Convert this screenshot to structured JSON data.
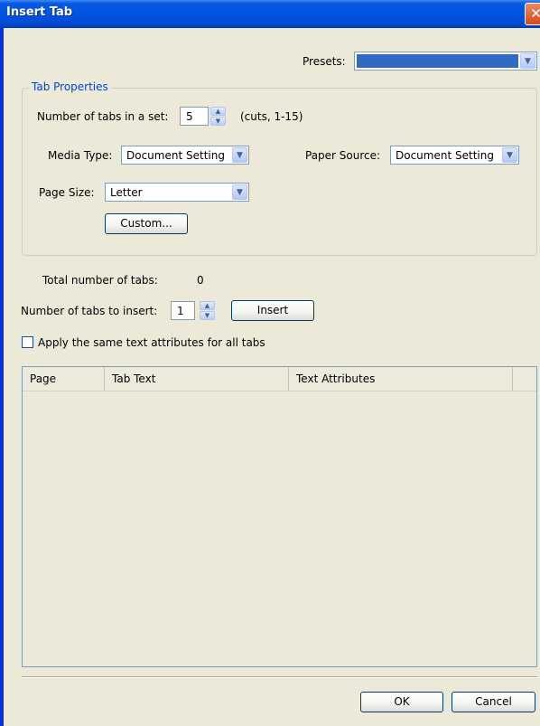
{
  "window": {
    "title": "Insert Tab",
    "close_glyph": "✕"
  },
  "presets": {
    "label": "Presets:",
    "value": ""
  },
  "tab_properties": {
    "legend": "Tab Properties",
    "tabs_in_set_label": "Number of tabs in a set:",
    "tabs_in_set_value": "5",
    "tabs_in_set_hint": "(cuts, 1-15)",
    "media_type_label": "Media Type:",
    "media_type_value": "Document Setting",
    "paper_source_label": "Paper Source:",
    "paper_source_value": "Document Setting",
    "page_size_label": "Page Size:",
    "page_size_value": "Letter",
    "custom_button": "Custom..."
  },
  "total_tabs": {
    "label": "Total number of tabs:",
    "value": "0"
  },
  "insert": {
    "label": "Number of tabs to insert:",
    "value": "1",
    "button": "Insert"
  },
  "apply_same": {
    "label": "Apply the same text attributes for all tabs",
    "checked": false
  },
  "table": {
    "columns": [
      "Page",
      "Tab Text",
      "Text Attributes"
    ],
    "rows": []
  },
  "footer": {
    "ok": "OK",
    "cancel": "Cancel"
  },
  "icons": {
    "dropdown": "chevron-down-icon",
    "spin_up": "spin-up-icon",
    "spin_down": "spin-down-icon"
  },
  "colors": {
    "titlebar": "#0054e3",
    "close": "#d24b1c",
    "presets_selection": "#316ac5",
    "legend": "#0046d5"
  }
}
